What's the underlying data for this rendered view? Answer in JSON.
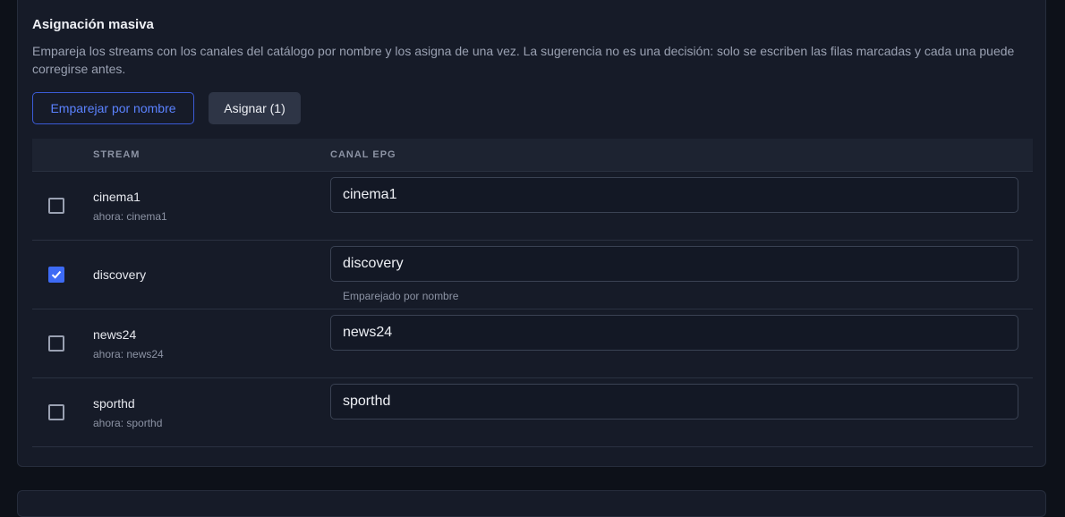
{
  "panel": {
    "title": "Asignación masiva",
    "description": "Empareja los streams con los canales del catálogo por nombre y los asigna de una vez. La sugerencia no es una decisión: solo se escriben las filas marcadas y cada una puede corregirse antes."
  },
  "actions": {
    "match_label": "Emparejar por nombre",
    "assign_label": "Asignar (1)"
  },
  "table": {
    "headers": {
      "stream": "STREAM",
      "canal": "CANAL EPG"
    },
    "rows": [
      {
        "checked": false,
        "stream": "cinema1",
        "now": "ahora: cinema1",
        "epg_value": "cinema1",
        "hint": ""
      },
      {
        "checked": true,
        "stream": "discovery",
        "now": "",
        "epg_value": "discovery",
        "hint": "Emparejado por nombre"
      },
      {
        "checked": false,
        "stream": "news24",
        "now": "ahora: news24",
        "epg_value": "news24",
        "hint": ""
      },
      {
        "checked": false,
        "stream": "sporthd",
        "now": "ahora: sporthd",
        "epg_value": "sporthd",
        "hint": ""
      }
    ]
  },
  "colors": {
    "accent": "#3d6bf5",
    "background": "#0d1119",
    "panel": "#161b28"
  }
}
